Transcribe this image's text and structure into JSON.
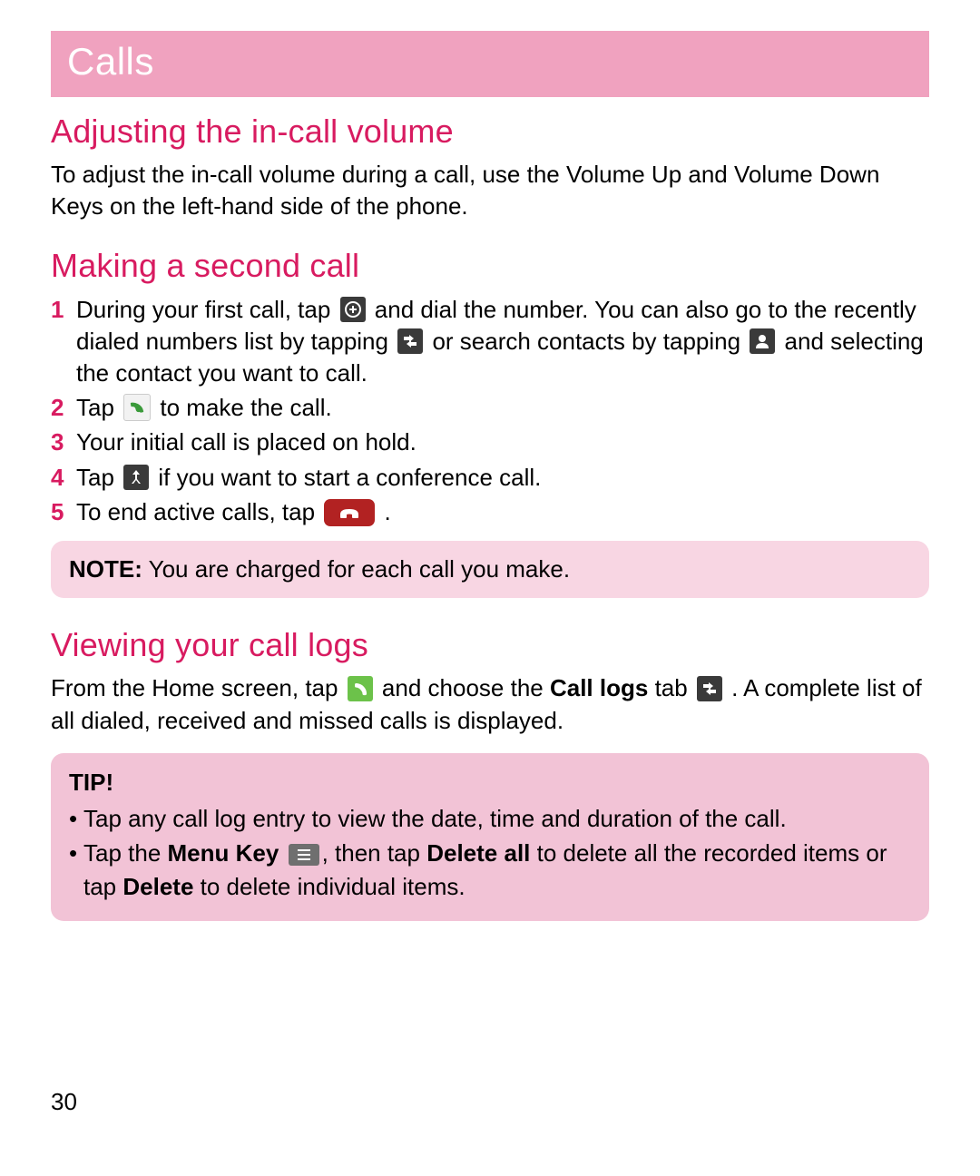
{
  "chapter": "Calls",
  "page_number": "30",
  "section1": {
    "heading": "Adjusting the in-call volume",
    "body": "To adjust the in-call volume during a call, use the Volume Up and Volume Down Keys on the left-hand side of the phone."
  },
  "section2": {
    "heading": "Making a second call",
    "steps": {
      "n1": "1",
      "s1a": "During your first call, tap ",
      "s1b": " and dial the number. You can also go to the recently dialed numbers list by tapping ",
      "s1c": " or search contacts by tapping ",
      "s1d": " and selecting the contact you want to call.",
      "n2": "2",
      "s2a": "Tap ",
      "s2b": " to make the call.",
      "n3": "3",
      "s3": "Your initial call is placed on hold.",
      "n4": "4",
      "s4a": "Tap ",
      "s4b": " if you want to start a conference call.",
      "n5": "5",
      "s5a": "To end active calls, tap ",
      "s5b": "."
    },
    "note_label": "NOTE:",
    "note_body": " You are charged for each call you make."
  },
  "section3": {
    "heading": "Viewing your call logs",
    "p_a": "From the Home screen, tap ",
    "p_b": " and choose the ",
    "p_bold1": "Call logs",
    "p_c": " tab ",
    "p_d": ". A complete list of all dialed, received and missed calls is displayed.",
    "tip_label": "TIP!",
    "tip1": "Tap any call log entry to view the date, time and duration of the call.",
    "tip2a": "Tap the ",
    "tip2_bold1": "Menu Key",
    "tip2b": " ",
    "tip2c": ", then tap ",
    "tip2_bold2": "Delete all",
    "tip2d": " to delete all the recorded items or tap ",
    "tip2_bold3": "Delete",
    "tip2e": " to delete individual items."
  }
}
